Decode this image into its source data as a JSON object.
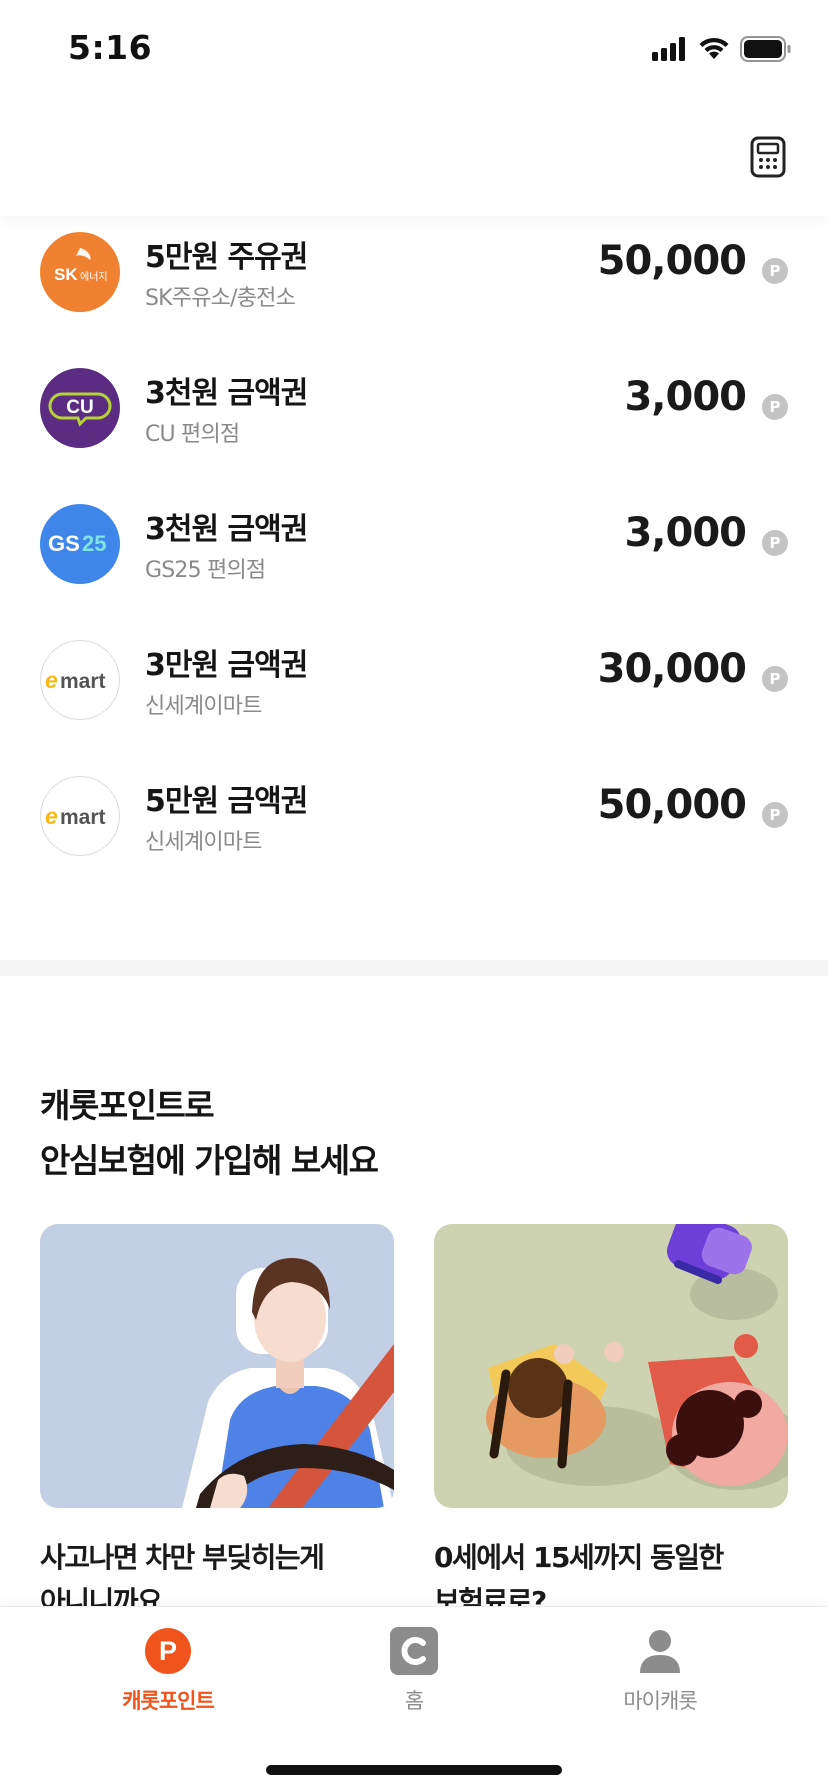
{
  "status_bar": {
    "time": "5:16"
  },
  "header": {
    "calculator_icon": "calculator-icon"
  },
  "coupons": [
    {
      "name": "5만원 주유권",
      "store": "SK주유소/충전소",
      "price": "50,000",
      "logo": "sk-energy-logo",
      "logo_text": "SK 에너지"
    },
    {
      "name": "3천원 금액권",
      "store": "CU 편의점",
      "price": "3,000",
      "logo": "cu-logo",
      "logo_text": "CU"
    },
    {
      "name": "3천원 금액권",
      "store": "GS25 편의점",
      "price": "3,000",
      "logo": "gs25-logo",
      "logo_text": "GS25"
    },
    {
      "name": "3만원 금액권",
      "store": "신세계이마트",
      "price": "30,000",
      "logo": "emart-logo",
      "logo_text": "emart"
    },
    {
      "name": "5만원 금액권",
      "store": "신세계이마트",
      "price": "50,000",
      "logo": "emart-logo",
      "logo_text": "emart"
    }
  ],
  "point_badge": "P",
  "insurance": {
    "title_line1": "캐롯포인트로",
    "title_line2": "안심보험에 가입해 보세요",
    "cards": [
      {
        "line1": "사고나면 차만 부딪히는게",
        "line2": "아니니까요"
      },
      {
        "line1": "0세에서 15세까지 동일한",
        "line2": "보험료로?"
      }
    ]
  },
  "tabs": [
    {
      "label": "캐롯포인트",
      "icon": "point-icon",
      "active": true
    },
    {
      "label": "홈",
      "icon": "home-c-icon",
      "active": false
    },
    {
      "label": "마이캐롯",
      "icon": "person-icon",
      "active": false
    }
  ],
  "colors": {
    "accent": "#f0541c",
    "sk_orange": "#f08130",
    "cu_purple": "#5b2d82",
    "gs_blue": "#3f86ea",
    "emart_yellow": "#f5b916",
    "badge_gray": "#c4c4c4"
  }
}
